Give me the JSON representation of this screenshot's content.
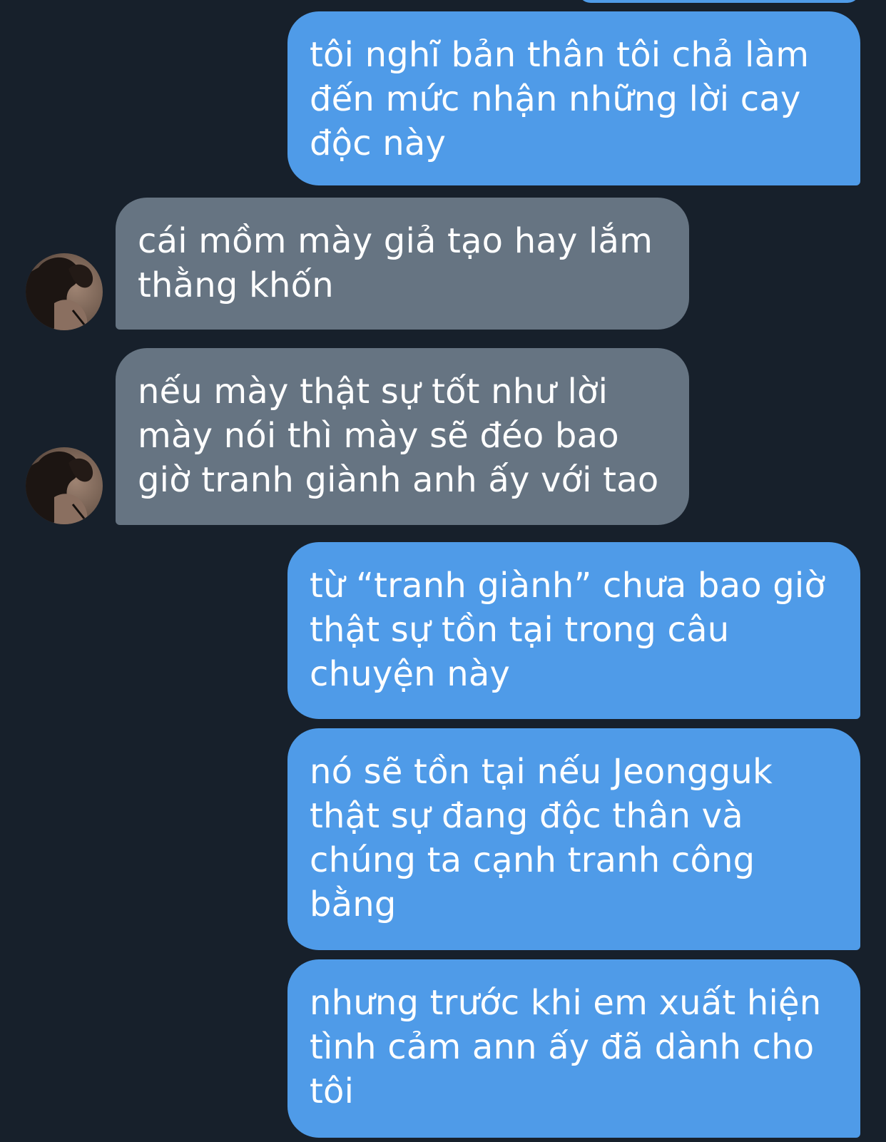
{
  "conversation": {
    "messages": [
      {
        "sender": "self",
        "text": "tôi nghĩ bản thân tôi chả làm\nđến mức nhận những lời cay\nđộc này"
      },
      {
        "sender": "contact",
        "text": "cái mồm mày giả tạo hay lắm\nthằng khốn"
      },
      {
        "sender": "contact",
        "text": "nếu mày thật sự tốt như lời\nmày nói thì mày sẽ đéo bao\ngiờ tranh giành anh ấy với tao"
      },
      {
        "sender": "self",
        "text": "từ “tranh giành” chưa bao giờ\nthật sự tồn tại trong câu\nchuyện này"
      },
      {
        "sender": "self",
        "text": "nó sẽ tồn tại nếu Jeongguk\nthật sự đang độc thân và\nchúng ta cạnh tranh công\nbằng"
      },
      {
        "sender": "self",
        "text": "nhưng trước khi em xuất hiện\ntình cảm ann ấy đã dành cho\ntôi"
      }
    ]
  },
  "colors": {
    "background": "#17202b",
    "outgoing_bubble": "#4f9be8",
    "incoming_bubble": "#667482",
    "text": "#ffffff"
  },
  "icons": {
    "contact_avatar": "profile-photo"
  }
}
